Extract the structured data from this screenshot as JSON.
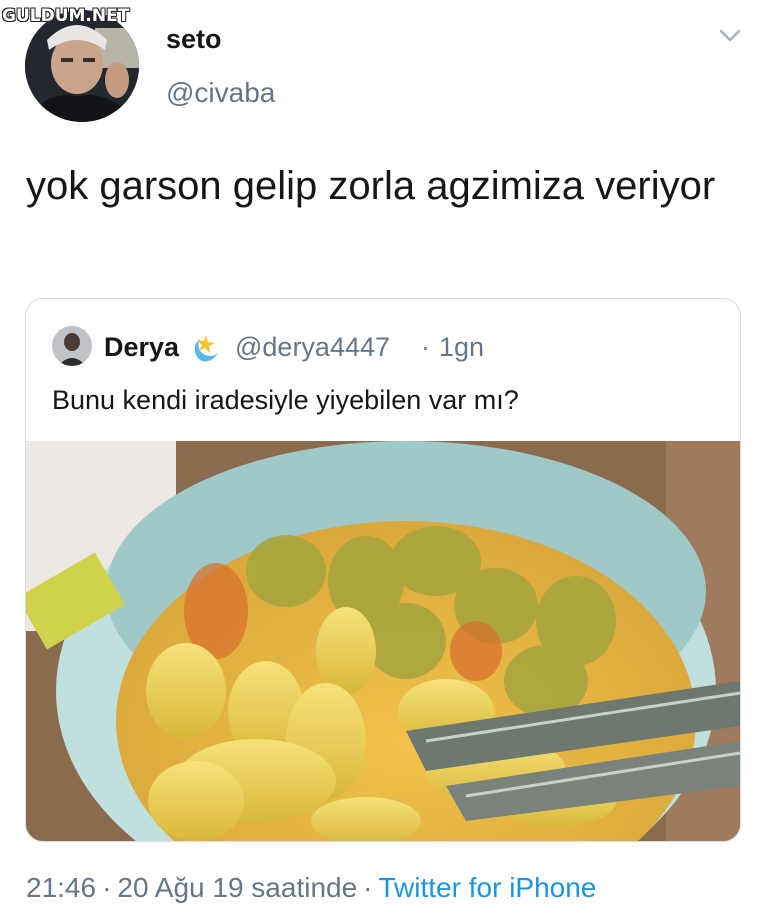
{
  "watermark": "GULDUM.NET",
  "tweet": {
    "display_name": "seto",
    "handle": "@civaba",
    "text": "yok garson gelip zorla agzimiza veriyor"
  },
  "quoted_tweet": {
    "display_name": "Derya",
    "handle": "@derya4447",
    "separator": "·",
    "time": "1gn",
    "text": "Bunu kendi iradesiyle  yiyebilen var mı?"
  },
  "footer": {
    "time": "21:46",
    "sep1": "·",
    "date": "20 Ağu 19 saatinde",
    "sep2": "·",
    "source": "Twitter for iPhone"
  },
  "icons": {
    "menu": "chevron-down-icon",
    "emoji": "sparkle-moon-emoji-icon"
  },
  "colors": {
    "link": "#1b95e0",
    "secondary_text": "#657786",
    "border": "#d8dde1"
  }
}
